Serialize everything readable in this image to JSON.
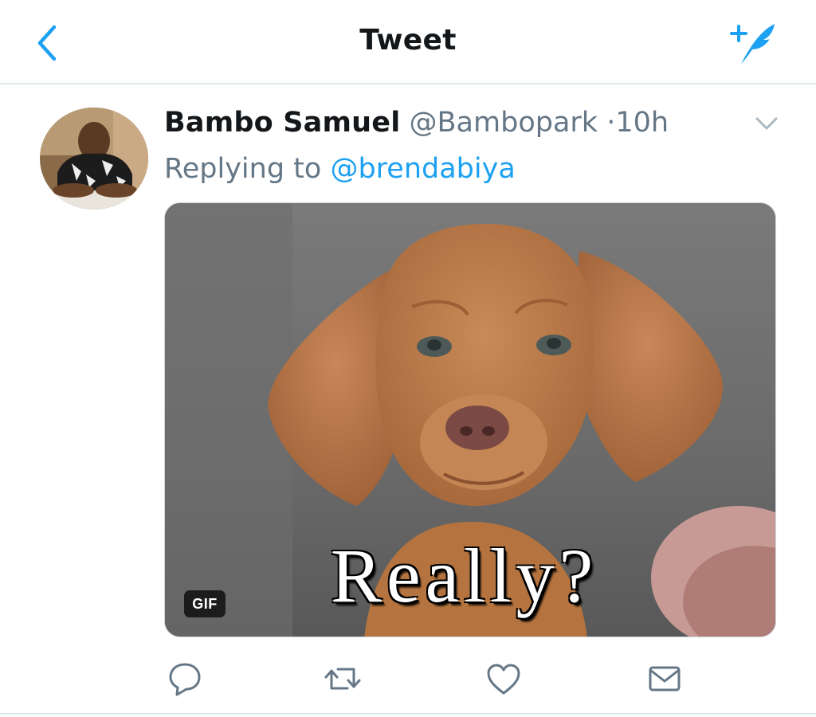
{
  "header": {
    "title": "Tweet",
    "back_icon": "chevron-left-icon",
    "compose_icon": "compose-feather-icon"
  },
  "tweet": {
    "author_name": "Bambo Samuel",
    "author_handle": "@Bambopark",
    "separator": "·",
    "time": "10h",
    "reply_prefix": "Replying to",
    "reply_to": "@brendabiya",
    "media": {
      "type": "gif",
      "badge": "GIF",
      "caption_text": "Really?"
    }
  },
  "actions": [
    {
      "name": "reply",
      "icon": "reply-bubble-icon"
    },
    {
      "name": "retweet",
      "icon": "retweet-icon"
    },
    {
      "name": "like",
      "icon": "heart-icon"
    },
    {
      "name": "share",
      "icon": "envelope-icon"
    }
  ],
  "colors": {
    "accent": "#1da1f2",
    "muted_text": "#657786",
    "primary_text": "#14171a",
    "divider": "#e1e8ed"
  }
}
